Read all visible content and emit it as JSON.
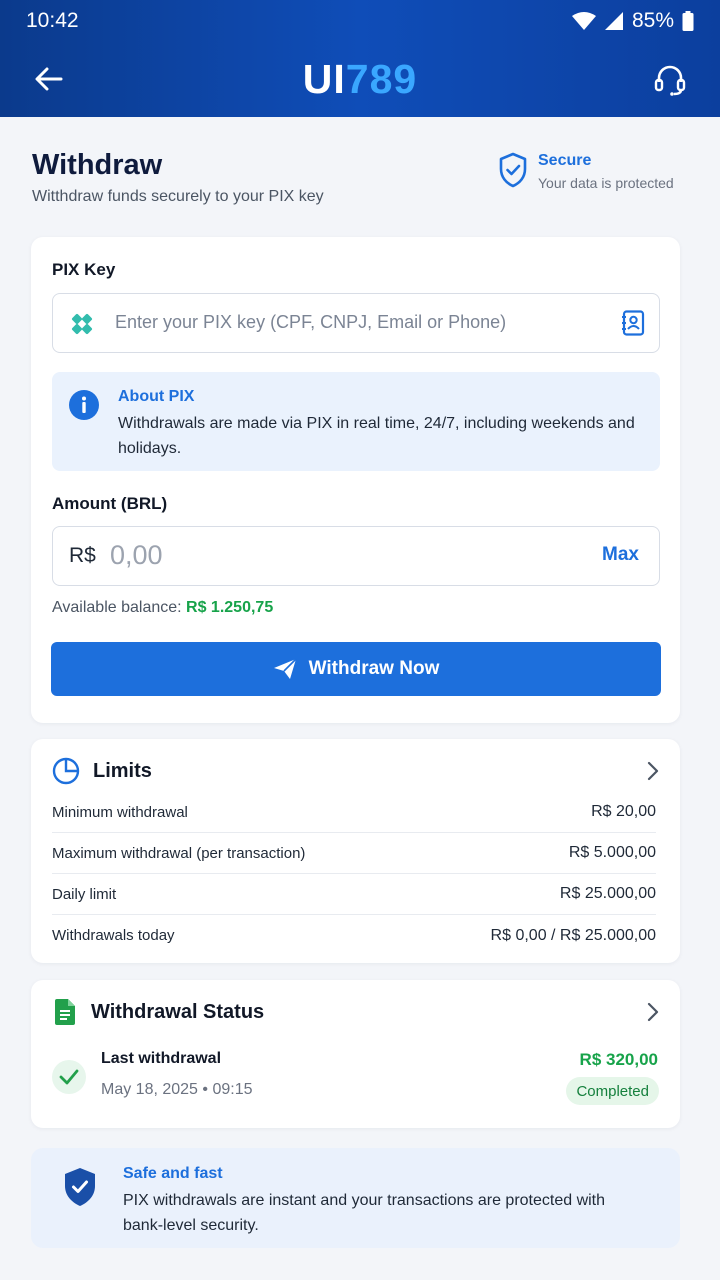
{
  "status_bar": {
    "time": "10:42",
    "battery": "85%"
  },
  "header": {
    "logo_part1": "UI",
    "logo_part2": "789",
    "brand_color": "#0f4db8",
    "accent_color": "#3aa7ff",
    "back_icon": "arrow-left-icon",
    "support_icon": "headset-icon"
  },
  "page": {
    "title": "Withdraw",
    "subtitle": "Witthdraw funds securely to your PIX key",
    "secure_title": "Secure",
    "secure_sub": "Your data is protected"
  },
  "form": {
    "pix_label": "PIX Key",
    "pix_placeholder": "Enter your PIX key (CPF, CNPJ, Email or Phone)",
    "pix_value": "",
    "info_title": "About PIX",
    "info_text": "Withdrawals are made via PIX in real time, 24/7, including weekends and holidays.",
    "amount_label": "Amount (BRL)",
    "currency_prefix": "R$",
    "amount_placeholder": "0,00",
    "amount_value": "",
    "max_label": "Max",
    "balance_label": "Available balance:",
    "balance_value": "R$ 1.250,75",
    "withdraw_label": "Withdraw Now",
    "primary_color": "#1d6fdc",
    "success_color": "#17a34a"
  },
  "limits": {
    "title": "Limits",
    "rows": [
      {
        "label": "Minimum withdrawal",
        "value": "R$ 20,00"
      },
      {
        "label": "Maximum withdrawal (per transaction)",
        "value": "R$ 5.000,00"
      },
      {
        "label": "Daily limit",
        "value": "R$ 25.000,00"
      },
      {
        "label": "Withdrawals today",
        "value": "R$ 0,00 / R$ 25.000,00"
      }
    ]
  },
  "status": {
    "title": "Withdrawal Status",
    "last_title": "Last withdrawal",
    "last_date": "May 18, 2025 • 09:15",
    "last_amount": "R$ 320,00",
    "badge": "Completed"
  },
  "safe": {
    "title": "Safe and fast",
    "text": "PIX withdrawals are instant and your transactions are protected with bank-level security."
  }
}
